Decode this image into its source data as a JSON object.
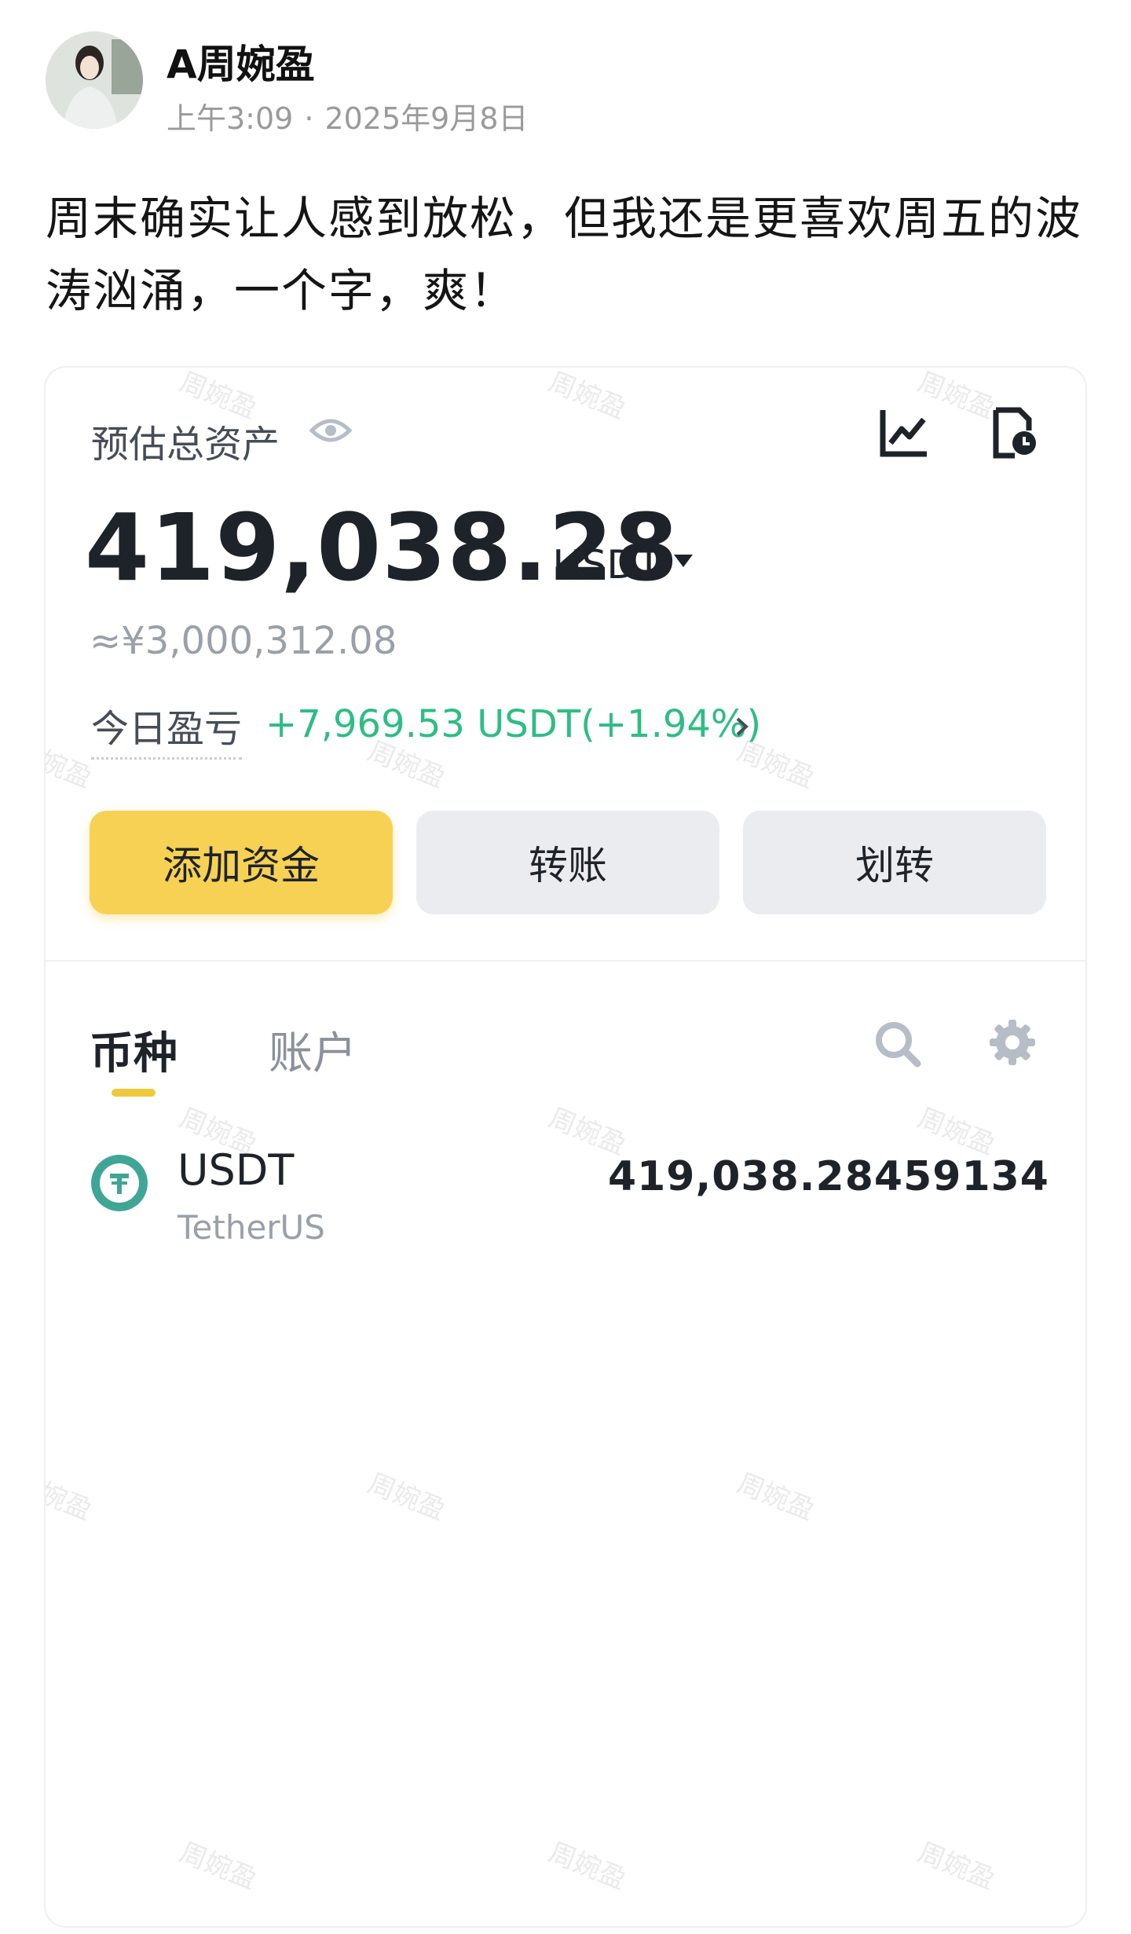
{
  "post": {
    "author": "A周婉盈",
    "time": "上午3:09",
    "separator": "·",
    "date": "2025年9月8日",
    "text": "周末确实让人感到放松，但我还是更喜欢周五的波涛汹涌，一个字，爽！"
  },
  "wallet": {
    "estimated_label": "预估总资产",
    "balance": "419,038.28",
    "unit": "USDT",
    "fiat_equivalent": "≈¥3,000,312.08",
    "pnl_label": "今日盈亏",
    "pnl_value": "+7,969.53 USDT(+1.94%)",
    "buttons": {
      "add_funds": "添加资金",
      "transfer": "转账",
      "move": "划转"
    },
    "tabs": [
      "币种",
      "账户"
    ],
    "assets": [
      {
        "symbol": "USDT",
        "name": "TetherUS",
        "amount": "419,038.28459134"
      }
    ]
  },
  "watermark": "周婉盈",
  "colors": {
    "accent_yellow": "#f6d153",
    "profit_green": "#2ebd85",
    "tether_green": "#3fa696"
  },
  "icons": [
    "eye-icon",
    "line-chart-icon",
    "history-icon",
    "caret-down-icon",
    "chevron-right-icon",
    "search-icon",
    "gear-icon",
    "tether-icon"
  ]
}
